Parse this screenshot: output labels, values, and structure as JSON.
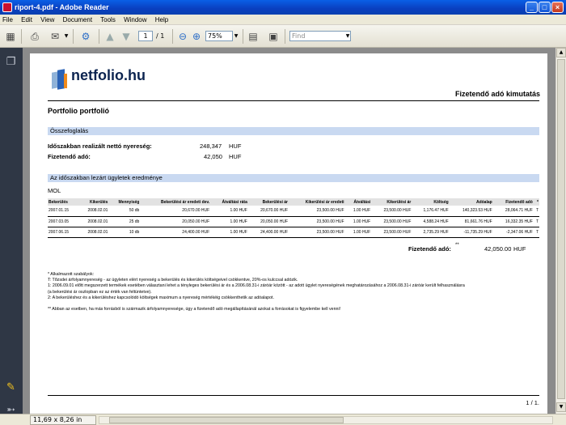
{
  "window": {
    "title": "riport-4.pdf - Adobe Reader",
    "controls": [
      "_",
      "□",
      "×"
    ]
  },
  "menu": [
    "File",
    "Edit",
    "View",
    "Document",
    "Tools",
    "Window",
    "Help"
  ],
  "toolbar": {
    "page_current": "1",
    "page_total": "/ 1",
    "zoom": "75%",
    "find_placeholder": "Find"
  },
  "status": {
    "page_size": "11,69 x 8,26 in"
  },
  "report": {
    "logo_text": "netfolio.hu",
    "report_title": "Fizetendő adó kimutatás",
    "portfolio_title": "Portfolio portfolió",
    "summary": {
      "heading": "Összefoglalás",
      "rows": [
        {
          "label": "Időszakban realizált nettó nyereség:",
          "value": "248,347",
          "unit": "HUF"
        },
        {
          "label": "Fizetendő adó:",
          "value": "42,050",
          "unit": "HUF"
        }
      ]
    },
    "closed": {
      "heading": "Az időszakban lezárt ügyletek eredménye",
      "instrument": "MOL",
      "columns": [
        "Bekerülés",
        "Kikerülés",
        "Mennyiség",
        "Bekerülési ár eredeti dev.",
        "Átváltási ráta",
        "Bekerülési ár",
        "Kikerülési ár eredeti",
        "Átváltási",
        "Kikerülési ár",
        "Költség",
        "Adóalap",
        "Fizetendő adó",
        "*"
      ],
      "rows": [
        [
          "2007.01.15",
          "2008.02.01",
          "50 db",
          "20,670.00  HUF",
          "1.00  HUF",
          "20,670.00  HUF",
          "23,500.00  HUF",
          "1.00  HUF",
          "23,500.00  HUF",
          "1,176.47  HUF",
          "140,323.53  HUF",
          "28,064.71  HUF",
          "T"
        ],
        [
          "2007.03.05",
          "2008.02.01",
          "25 db",
          "20,050.00  HUF",
          "1.00  HUF",
          "20,050.00  HUF",
          "23,500.00  HUF",
          "1.00  HUF",
          "23,500.00  HUF",
          "4,588.24  HUF",
          "81,661.76  HUF",
          "16,332.35  HUF",
          "T"
        ],
        [
          "2007.06.15",
          "2008.02.01",
          "10 db",
          "24,400.00  HUF",
          "1.00  HUF",
          "24,400.00  HUF",
          "23,500.00  HUF",
          "1.00  HUF",
          "23,500.00  HUF",
          "2,735.29  HUF",
          "-11,735.29  HUF",
          "-2,347.06  HUF",
          "T"
        ]
      ],
      "total_label": "Fizetendő adó:",
      "total_mark": "**",
      "total_value": "42,050.00",
      "total_unit": "HUF"
    },
    "notes": [
      "* Alkalmazott szabályok:",
      "T: Tőzsdei árfolyamnyereség - az ügyleten elért nyereség a bekerülés és kikerülés költségeivel csökkentve, 20%-os kulccsal adózik.",
      "1: 2006.09.01 előtt megszerzett termékek esetében választani lehet a tényleges bekerülési ár és a 2006.08.31-i záróár között - az adott ügylet nyereségének meghatározásához a 2006.08.31-i záróár került felhasználásra",
      "(a bekerülési ár oszlopban ez az érték van feltüntetve).",
      "2: A bekerüléshez és a kikerüléshez kapcsolódó költségek maximum a nyereség mértékéig csökkenthetik az adóalapot.",
      "",
      "** Abban az esetben, ha más forrásból is származik árfolyamnyeresége, úgy a fizetendő adó megállapításánál azokat a forrásokat is figyelembe kell venni!"
    ],
    "page_number": "1 / 1."
  }
}
